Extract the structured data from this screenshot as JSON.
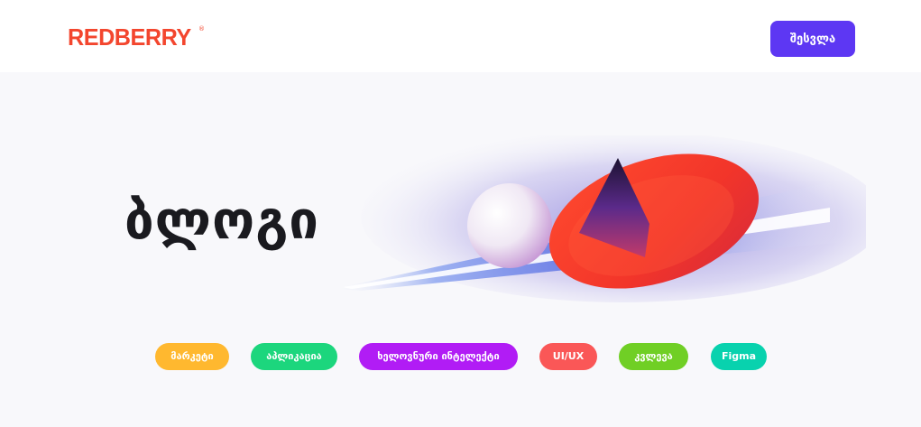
{
  "header": {
    "logo_text": "REDBERRY",
    "logo_mark": "®",
    "login_label": "შესვლა"
  },
  "hero": {
    "title": "ბლოგი",
    "illustration": "abstract-planet-ring-illustration"
  },
  "categories": [
    {
      "label": "მარკეტი",
      "color": "#FFB82F"
    },
    {
      "label": "აპლიკაცია",
      "color": "#1CD67D"
    },
    {
      "label": "ხელოვნური ინტელექტი",
      "color": "#B11CF5"
    },
    {
      "label": "UI/UX",
      "color": "#FA5757"
    },
    {
      "label": "კვლევა",
      "color": "#70CF25"
    },
    {
      "label": "Figma",
      "color": "#08D2AE"
    }
  ],
  "colors": {
    "brand": "#F3462E",
    "accent": "#5D37F3",
    "background": "#F8F8FB",
    "header_bg": "#FFFFFF",
    "title_text": "#1A1A1F"
  }
}
